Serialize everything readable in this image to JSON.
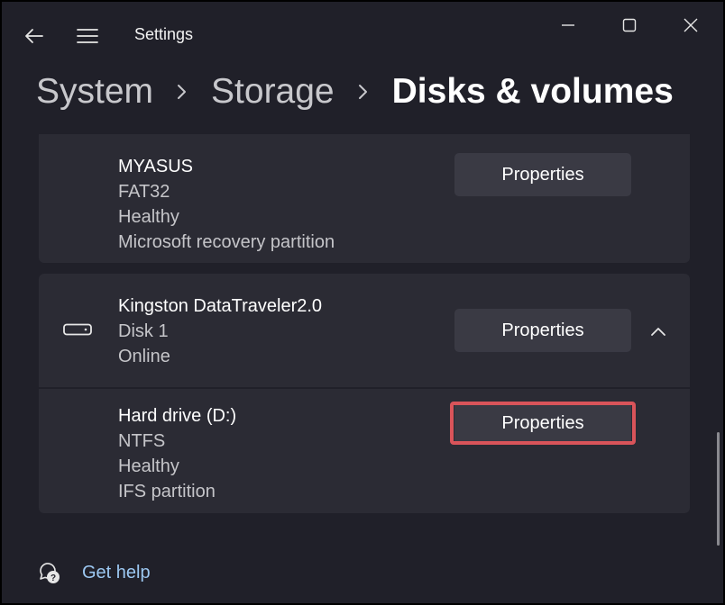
{
  "window": {
    "title": "Settings"
  },
  "titlebar": {
    "back_icon": "back-arrow-icon",
    "menu_icon": "hamburger-menu-icon",
    "minimize_icon": "minimize-icon",
    "maximize_icon": "maximize-icon",
    "close_icon": "close-icon"
  },
  "breadcrumb": {
    "items": [
      "System",
      "Storage",
      "Disks & volumes"
    ],
    "separator_icon": "chevron-right-icon"
  },
  "volumes": [
    {
      "name": "MYASUS",
      "filesystem": "FAT32",
      "health": "Healthy",
      "type": "Microsoft recovery partition",
      "button_label": "Properties"
    }
  ],
  "disk": {
    "name": "Kingston DataTraveler2.0",
    "number": "Disk 1",
    "status": "Online",
    "button_label": "Properties",
    "icon": "drive-icon",
    "expand_icon": "chevron-up-icon",
    "volumes": [
      {
        "name": "Hard drive (D:)",
        "filesystem": "NTFS",
        "health": "Healthy",
        "type": "IFS partition",
        "button_label": "Properties",
        "highlighted": true,
        "highlight_color": "#d9545a"
      }
    ]
  },
  "help": {
    "label": "Get help",
    "icon": "help-chat-icon"
  },
  "colors": {
    "background": "#202029",
    "card": "#2b2b34",
    "button": "#3a3a44",
    "link": "#9cc8f2",
    "highlight": "#d9545a"
  }
}
